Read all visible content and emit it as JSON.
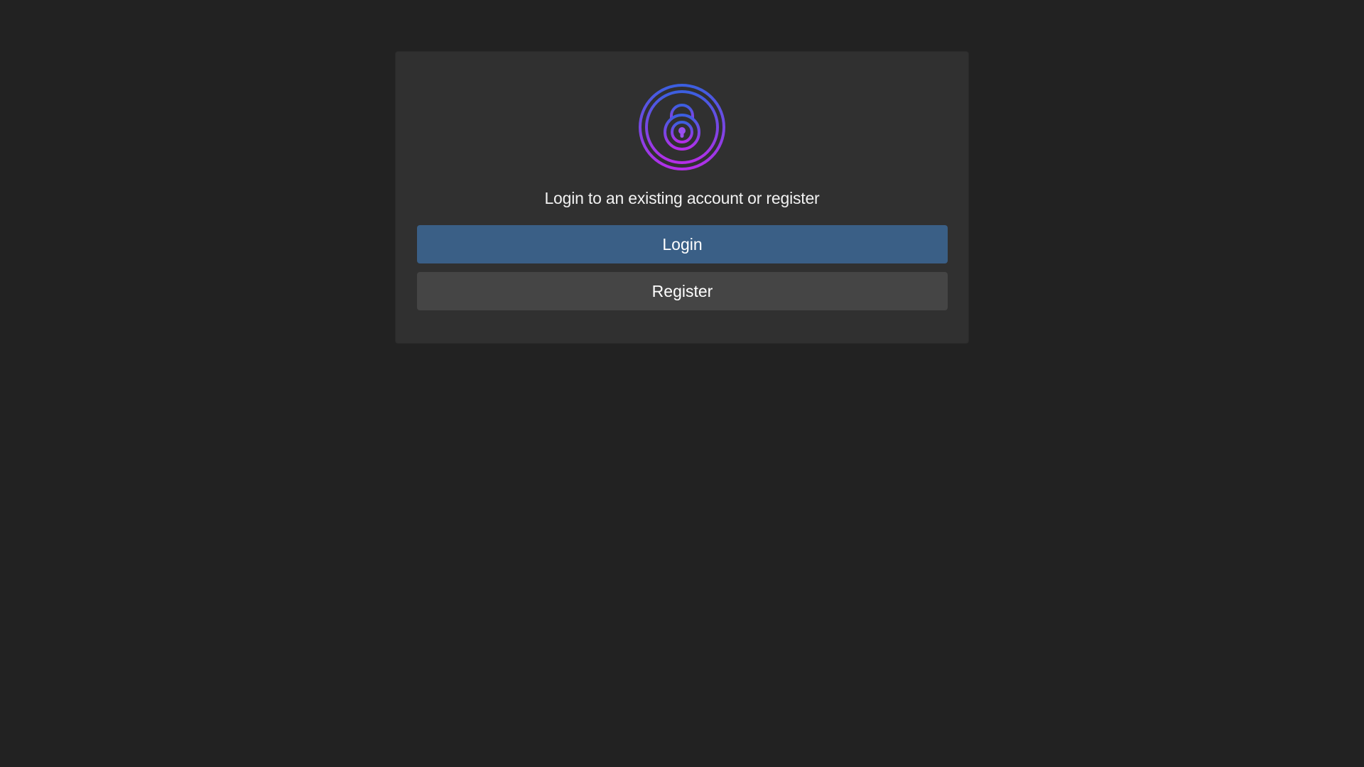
{
  "auth": {
    "logo_icon": "padlock-icon",
    "prompt": "Login to an existing account or register",
    "login_label": "Login",
    "register_label": "Register"
  },
  "colors": {
    "background": "#222222",
    "card": "#303030",
    "login_button": "#3a5f86",
    "register_button": "#454545",
    "logo_gradient_start": "#3b5fe0",
    "logo_gradient_end": "#b52ee8"
  }
}
